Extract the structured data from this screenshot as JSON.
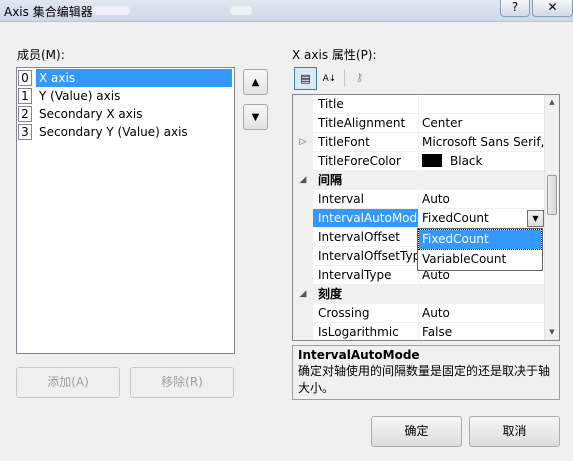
{
  "window": {
    "title": "Axis 集合编辑器",
    "help_label": "?",
    "close_label": "✕"
  },
  "members": {
    "label": "成员(M):",
    "items": [
      {
        "index": "0",
        "name": "X axis",
        "selected": true
      },
      {
        "index": "1",
        "name": "Y (Value) axis",
        "selected": false
      },
      {
        "index": "2",
        "name": "Secondary X axis",
        "selected": false
      },
      {
        "index": "3",
        "name": "Secondary Y (Value) axis",
        "selected": false
      }
    ],
    "move_up_icon": "▲",
    "move_down_icon": "▼",
    "add_label": "添加(A)",
    "remove_label": "移除(R)"
  },
  "properties": {
    "label": "X axis 属性(P):",
    "toolbar": {
      "categorized_icon": "▤",
      "alphabetical_icon": "A↓",
      "pages_icon": "⚷"
    },
    "rows": [
      {
        "type": "prop",
        "name": "Title",
        "value": ""
      },
      {
        "type": "prop",
        "name": "TitleAlignment",
        "value": "Center"
      },
      {
        "type": "prop",
        "name": "TitleFont",
        "value": "Microsoft Sans Serif,",
        "expander": "▷"
      },
      {
        "type": "prop",
        "name": "TitleForeColor",
        "value": "Black",
        "swatch": "#000000"
      },
      {
        "type": "cat",
        "name": "间隔",
        "expander": "◢"
      },
      {
        "type": "prop",
        "name": "Interval",
        "value": "Auto"
      },
      {
        "type": "prop",
        "name": "IntervalAutoMode",
        "value": "FixedCount",
        "selected": true
      },
      {
        "type": "prop",
        "name": "IntervalOffset",
        "value": ""
      },
      {
        "type": "prop",
        "name": "IntervalOffsetType",
        "value": ""
      },
      {
        "type": "prop",
        "name": "IntervalType",
        "value": "Auto"
      },
      {
        "type": "cat",
        "name": "刻度",
        "expander": "◢"
      },
      {
        "type": "prop",
        "name": "Crossing",
        "value": "Auto"
      },
      {
        "type": "prop",
        "name": "IsLogarithmic",
        "value": "False"
      }
    ],
    "dropdown": {
      "arrow": "▼",
      "options": [
        {
          "label": "FixedCount",
          "selected": true
        },
        {
          "label": "VariableCount",
          "selected": false
        }
      ]
    },
    "description": {
      "title": "IntervalAutoMode",
      "text": "确定对轴使用的间隔数量是固定的还是取决于轴大小。"
    }
  },
  "footer": {
    "ok_label": "确定",
    "cancel_label": "取消"
  },
  "colors": {
    "selection": "#3399ff",
    "window_bg": "#f0f0f0"
  }
}
